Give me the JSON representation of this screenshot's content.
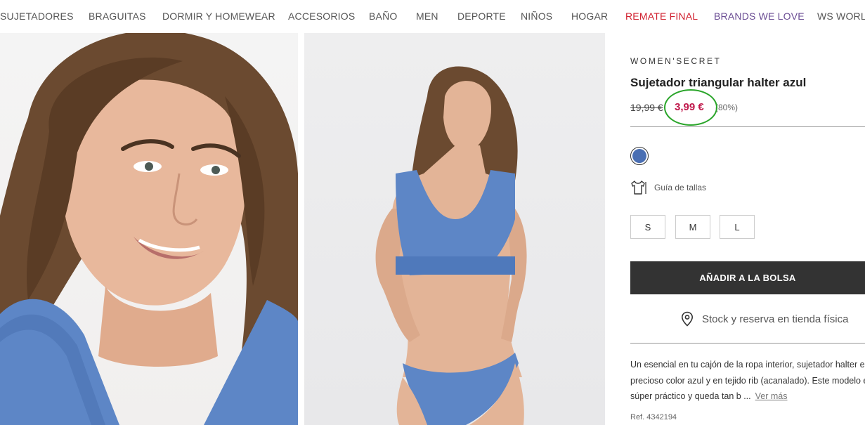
{
  "nav": {
    "items": [
      {
        "label": "SUJETADORES"
      },
      {
        "label": "BRAGUITAS"
      },
      {
        "label": "DORMIR Y HOMEWEAR"
      },
      {
        "label": "ACCESORIOS"
      },
      {
        "label": "BAÑO"
      },
      {
        "label": "MEN"
      },
      {
        "label": "DEPORTE"
      },
      {
        "label": "NIÑOS"
      },
      {
        "label": "HOGAR"
      },
      {
        "label": "REMATE FINAL"
      },
      {
        "label": "BRANDS WE LOVE"
      },
      {
        "label": "WS WORLD"
      }
    ],
    "sale_color": "#d0202f",
    "brands_color": "#6a4c93"
  },
  "product": {
    "brand": "WOMEN'SECRET",
    "title": "Sujetador triangular halter azul",
    "old_price": "19,99 €",
    "price": "3,99 €",
    "discount": "(80%)",
    "price_color": "#c0184b",
    "swatch_color": "#4a6fb3",
    "size_guide_label": "Guía de tallas",
    "sizes": [
      "S",
      "M",
      "L"
    ],
    "add_to_bag": "AÑADIR A LA BOLSA",
    "stock_label": "Stock y reserva en tienda física",
    "description_lines": [
      "Un esencial en tu cajón de la ropa interior, sujetador halter en",
      "precioso color azul y en tejido rib (acanalado). Este modelo es",
      "súper práctico y queda tan b ..."
    ],
    "more_label": "Ver más",
    "ref": "Ref. 4342194"
  }
}
